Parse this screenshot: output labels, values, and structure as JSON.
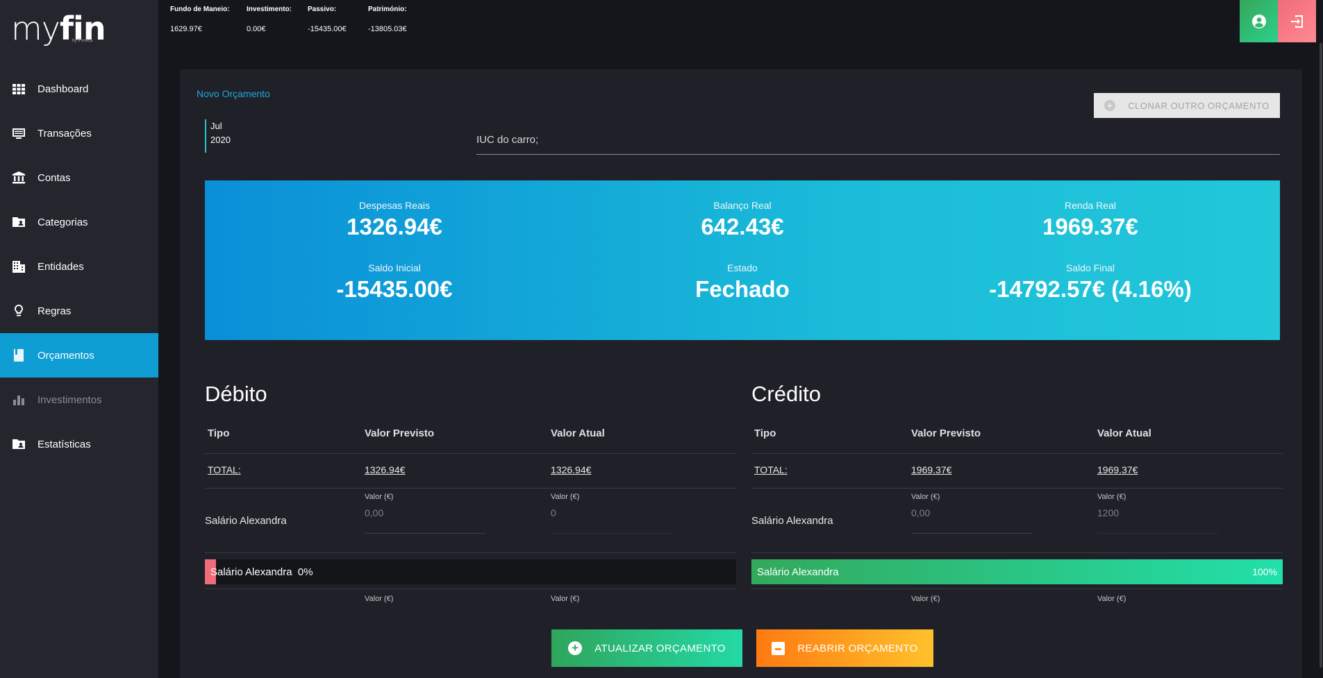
{
  "app": {
    "logo_my": "my",
    "logo_fin": "fin",
    "logo_sub": "by iFoneca"
  },
  "sidebar": {
    "items": [
      {
        "label": "Dashboard",
        "icon": "grid-icon"
      },
      {
        "label": "Transações",
        "icon": "list-icon"
      },
      {
        "label": "Contas",
        "icon": "bank-icon"
      },
      {
        "label": "Categorias",
        "icon": "folder-user-icon"
      },
      {
        "label": "Entidades",
        "icon": "building-icon"
      },
      {
        "label": "Regras",
        "icon": "lightbulb-icon"
      },
      {
        "label": "Orçamentos",
        "icon": "book-icon",
        "active": true
      },
      {
        "label": "Investimentos",
        "icon": "bar-chart-icon",
        "disabled": true
      },
      {
        "label": "Estatísticas",
        "icon": "folder-user-icon"
      }
    ]
  },
  "topbar": {
    "stats": [
      {
        "label": "Fundo de Maneio:",
        "value": "1629.97€"
      },
      {
        "label": "Investimento:",
        "value": "0.00€"
      },
      {
        "label": "Passivo:",
        "value": "-15435.00€"
      },
      {
        "label": "Património:",
        "value": "-13805.03€"
      }
    ],
    "user_icon": "user-circle-icon",
    "logout_icon": "logout-icon",
    "colors": {
      "user": "#2bd18e",
      "logout": "#f06c7a"
    }
  },
  "budget": {
    "breadcrumb": "Novo Orçamento",
    "clone_label": "CLONAR OUTRO ORÇAMENTO",
    "month": "Jul",
    "year": "2020",
    "description": "IUC do carro;",
    "summary": {
      "despesas_label": "Despesas Reais",
      "despesas_value": "1326.94€",
      "balanco_label": "Balanço Real",
      "balanco_value": "642.43€",
      "renda_label": "Renda Real",
      "renda_value": "1969.37€",
      "saldo_ini_label": "Saldo Inicial",
      "saldo_ini_value": "-15435.00€",
      "estado_label": "Estado",
      "estado_value": "Fechado",
      "saldo_fin_label": "Saldo Final",
      "saldo_fin_value": "-14792.57€ (4.16%)"
    },
    "debit": {
      "title": "Débito",
      "headers": {
        "tipo": "Tipo",
        "previsto": "Valor Previsto",
        "atual": "Valor Atual"
      },
      "total_label": "TOTAL:",
      "total_previsto": "1326.94€",
      "total_atual": "1326.94€",
      "row": {
        "name": "Salário Alexandra",
        "field_label": "Valor (€)",
        "previsto": "0,00",
        "atual": "0"
      },
      "progress": {
        "label": "Salário Alexandra",
        "pct_text": "0%",
        "value": 0
      },
      "next_field_label": "Valor (€)"
    },
    "credit": {
      "title": "Crédito",
      "headers": {
        "tipo": "Tipo",
        "previsto": "Valor Previsto",
        "atual": "Valor Atual"
      },
      "total_label": "TOTAL:",
      "total_previsto": "1969.37€",
      "total_atual": "1969.37€",
      "row": {
        "name": "Salário Alexandra",
        "field_label": "Valor (€)",
        "previsto": "0,00",
        "atual": "1200"
      },
      "progress": {
        "label": "Salário Alexandra",
        "pct_text": "100%",
        "value": 100
      },
      "next_field_label": "Valor (€)"
    },
    "update_label": "ATUALIZAR ORÇAMENTO",
    "reopen_label": "REABRIR ORÇAMENTO"
  }
}
